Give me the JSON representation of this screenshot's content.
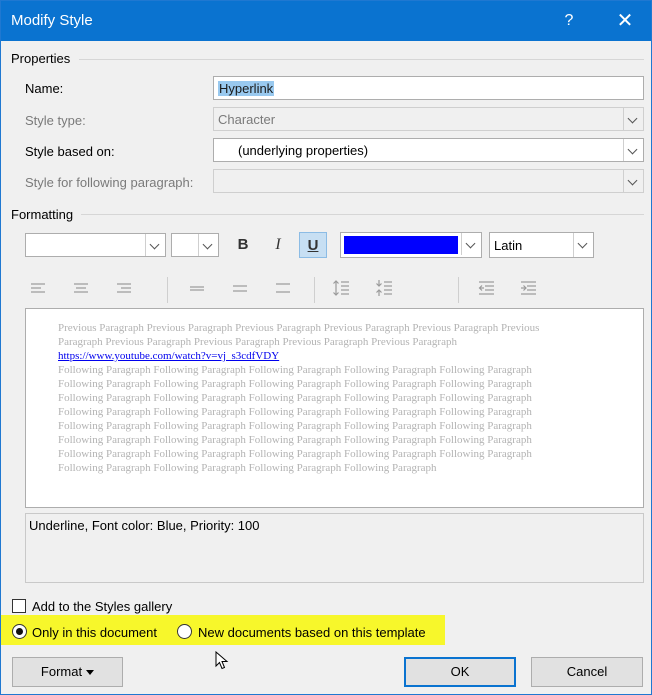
{
  "window": {
    "title": "Modify Style",
    "help_label": "?",
    "close_label": "✕"
  },
  "properties": {
    "section_label": "Properties",
    "name_label": "Name:",
    "name_value": "Hyperlink",
    "style_type_label": "Style type:",
    "style_type_value": "Character",
    "based_on_label": "Style based on:",
    "based_on_value": "(underlying properties)",
    "following_label": "Style for following paragraph:",
    "following_value": ""
  },
  "formatting": {
    "section_label": "Formatting",
    "font_name_value": "",
    "font_size_value": "",
    "bold_label": "B",
    "italic_label": "I",
    "underline_label": "U",
    "font_color": "#0000ff",
    "script_value": "Latin"
  },
  "preview": {
    "previous_text": "Previous Paragraph Previous Paragraph Previous Paragraph Previous Paragraph Previous Paragraph Previous Paragraph Previous Paragraph Previous Paragraph Previous Paragraph Previous Paragraph",
    "link_text": "https://www.youtube.com/watch?v=vj_s3cdfVDY",
    "following_lines": [
      "Following Paragraph Following Paragraph Following Paragraph Following Paragraph Following Paragraph",
      "Following Paragraph Following Paragraph Following Paragraph Following Paragraph Following Paragraph",
      "Following Paragraph Following Paragraph Following Paragraph Following Paragraph Following Paragraph",
      "Following Paragraph Following Paragraph Following Paragraph Following Paragraph Following Paragraph",
      "Following Paragraph Following Paragraph Following Paragraph Following Paragraph Following Paragraph",
      "Following Paragraph Following Paragraph Following Paragraph Following Paragraph Following Paragraph",
      "Following Paragraph Following Paragraph Following Paragraph Following Paragraph Following Paragraph",
      "Following Paragraph Following Paragraph Following Paragraph Following Paragraph"
    ]
  },
  "description": "Underline, Font color: Blue, Priority: 100",
  "options": {
    "add_to_gallery_label": "Add to the Styles gallery",
    "add_to_gallery_checked": false,
    "only_this_doc_label": "Only in this document",
    "new_docs_label": "New documents based on this template",
    "selected": "only_this_doc"
  },
  "buttons": {
    "format_label": "Format",
    "ok_label": "OK",
    "cancel_label": "Cancel"
  },
  "colors": {
    "titlebar": "#0a73d0",
    "highlight": "#f7f72b",
    "selection": "#99c9ef"
  }
}
